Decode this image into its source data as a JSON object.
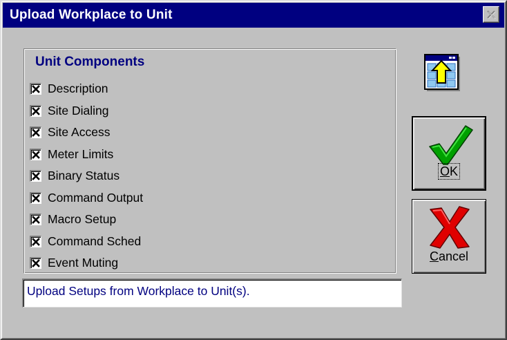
{
  "window": {
    "title": "Upload Workplace to Unit"
  },
  "group": {
    "title": "Unit Components",
    "items": [
      {
        "label": "Description",
        "checked": true
      },
      {
        "label": "Site Dialing",
        "checked": true
      },
      {
        "label": "Site Access",
        "checked": true
      },
      {
        "label": "Meter Limits",
        "checked": true
      },
      {
        "label": "Binary Status",
        "checked": true
      },
      {
        "label": "Command Output",
        "checked": true
      },
      {
        "label": "Macro Setup",
        "checked": true
      },
      {
        "label": "Command Sched",
        "checked": true
      },
      {
        "label": "Event Muting",
        "checked": true
      }
    ]
  },
  "status": {
    "text": "Upload Setups from Workplace to Unit(s)."
  },
  "buttons": {
    "ok": {
      "mnemonic": "O",
      "rest": "K",
      "icon": "green-checkmark-icon"
    },
    "cancel": {
      "mnemonic": "C",
      "rest": "ancel",
      "icon": "red-x-icon"
    }
  },
  "icons": {
    "upload": "upload-to-unit-icon",
    "close": "close-icon"
  },
  "colors": {
    "titlebar": "#000080",
    "face": "#c0c0c0",
    "group_title": "#000080",
    "status_text": "#000080",
    "ok_check": "#00a000",
    "cancel_x": "#e00000",
    "upload_arrow": "#ffff00"
  }
}
